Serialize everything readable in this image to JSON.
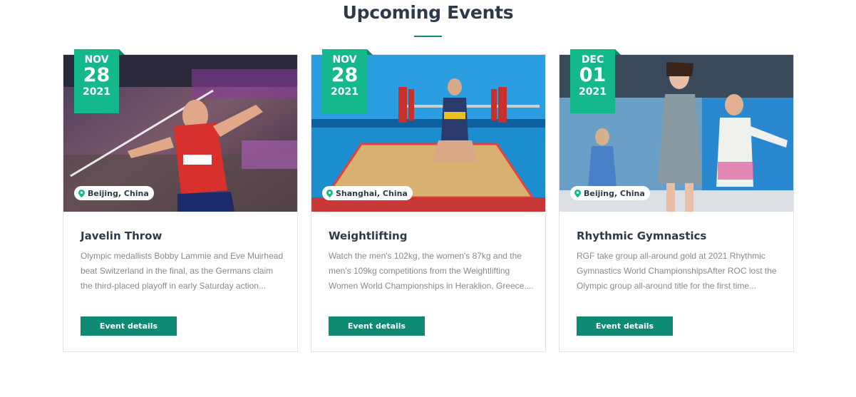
{
  "section": {
    "title": "Upcoming Events"
  },
  "events": [
    {
      "month": "NOV",
      "day": "28",
      "year": "2021",
      "location": "Beijing, China",
      "title": "Javelin Throw",
      "description": "Olympic medallists Bobby Lammie and Eve Muirhead beat Switzerland in the final, as the Germans claim the third-placed playoff in early Saturday action...",
      "button_label": "Event details"
    },
    {
      "month": "NOV",
      "day": "28",
      "year": "2021",
      "location": "Shanghai, China",
      "title": "Weightlifting",
      "description": "Watch the men's 102kg, the women's 87kg and the men's 109kg competitions from the Weightlifting Women World Championships in Heraklion, Greece....",
      "button_label": "Event details"
    },
    {
      "month": "DEC",
      "day": "01",
      "year": "2021",
      "location": "Beijing, China",
      "title": "Rhythmic Gymnastics",
      "description": "RGF take group all-around gold at 2021 Rhythmic Gymnastics World ChampionshipsAfter ROC lost the Olympic group all-around title for the first time...",
      "button_label": "Event details"
    }
  ],
  "colors": {
    "accent": "#14b88a",
    "button": "#0e8a72",
    "heading": "#2e3a4a",
    "text": "#8a8a8a"
  },
  "icons": {
    "location": "map-pin-icon"
  }
}
